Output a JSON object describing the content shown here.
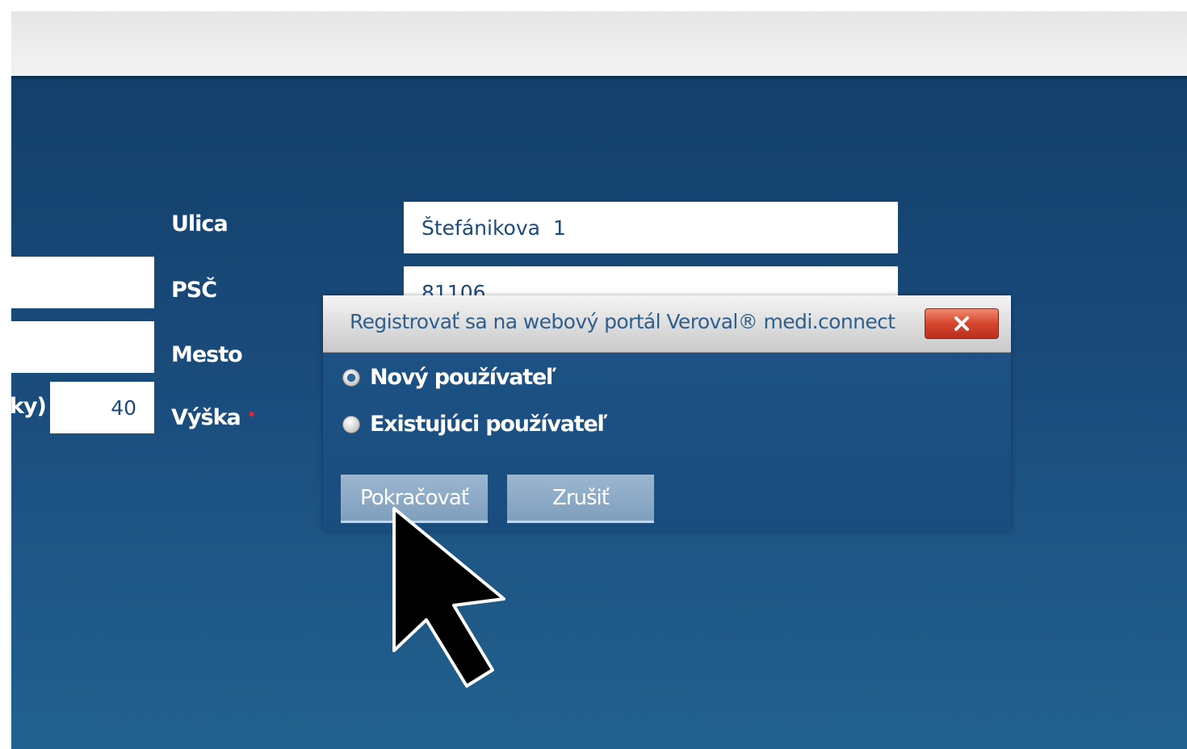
{
  "form": {
    "left_partial_label": "ky)",
    "weight_value": "40",
    "street_label": "Ulica",
    "street_value": "Štefánikova  1",
    "zip_label": "PSČ",
    "zip_value": "81106",
    "city_label": "Mesto",
    "height_label": "Výška",
    "required_mark": "•"
  },
  "dialog": {
    "title": "Registrovať sa na webový portál Veroval® medi.connect",
    "close_label": "x",
    "options": [
      {
        "label": "Nový používateľ",
        "selected": true
      },
      {
        "label": "Existujúci používateľ",
        "selected": false
      }
    ],
    "continue_label": "Pokračovať",
    "cancel_label": "Zrušiť"
  },
  "colors": {
    "background_blue": "#1a4c7c",
    "close_red": "#d6452e",
    "button_blue": "#8aa8c6"
  }
}
